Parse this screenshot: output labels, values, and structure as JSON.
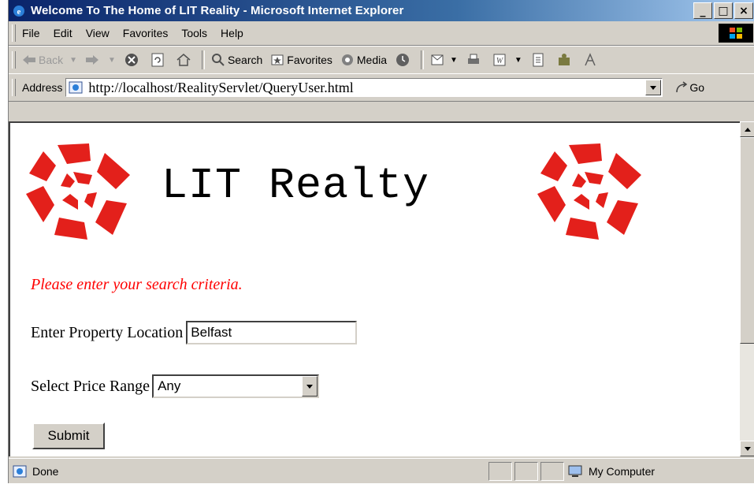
{
  "window": {
    "title": "Welcome To The Home of LIT Reality - Microsoft Internet Explorer",
    "controls": {
      "minimize": "_",
      "maximize": "□",
      "close": "×"
    }
  },
  "menu": {
    "items": [
      {
        "label": "File",
        "key": "F"
      },
      {
        "label": "Edit",
        "key": "E"
      },
      {
        "label": "View",
        "key": "V"
      },
      {
        "label": "Favorites",
        "key": "a"
      },
      {
        "label": "Tools",
        "key": "T"
      },
      {
        "label": "Help",
        "key": "H"
      }
    ]
  },
  "toolbar": {
    "back_label": "Back",
    "search_label": "Search",
    "favorites_label": "Favorites",
    "media_label": "Media"
  },
  "address": {
    "label": "Address",
    "url": "http://localhost/RealityServlet/QueryUser.html",
    "go_label": "Go"
  },
  "page": {
    "site_title": "LIT Realty",
    "prompt": "Please enter your search criteria.",
    "location_label": "Enter Property Location",
    "location_value": "Belfast",
    "price_label": "Select Price Range",
    "price_selected": "Any",
    "submit_label": "Submit"
  },
  "status": {
    "text": "Done",
    "zone": "My Computer"
  },
  "colors": {
    "logo_red": "#e3201b",
    "prompt_red": "#ff0000",
    "titlebar": "#0a246a"
  }
}
